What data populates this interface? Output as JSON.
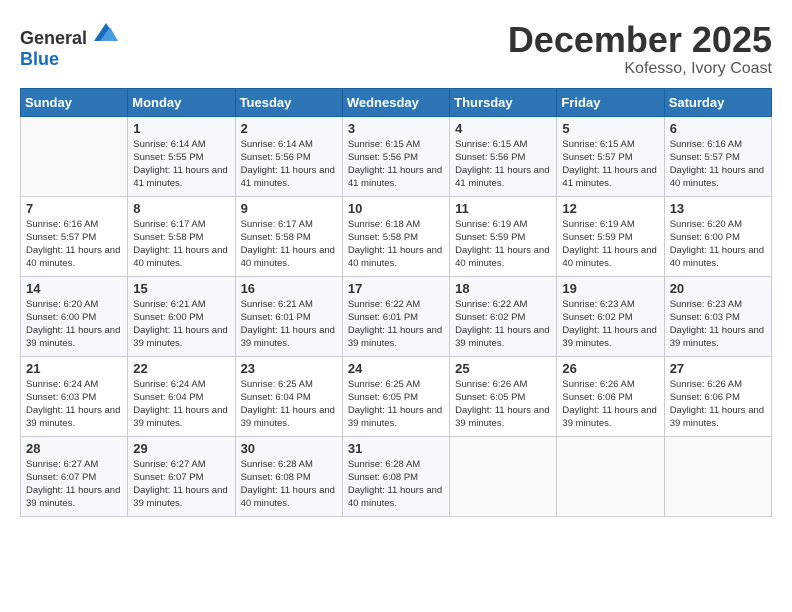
{
  "logo": {
    "general": "General",
    "blue": "Blue"
  },
  "title": {
    "month_year": "December 2025",
    "location": "Kofesso, Ivory Coast"
  },
  "weekdays": [
    "Sunday",
    "Monday",
    "Tuesday",
    "Wednesday",
    "Thursday",
    "Friday",
    "Saturday"
  ],
  "weeks": [
    [
      {
        "day": "",
        "sunrise": "",
        "sunset": "",
        "daylight": ""
      },
      {
        "day": "1",
        "sunrise": "Sunrise: 6:14 AM",
        "sunset": "Sunset: 5:55 PM",
        "daylight": "Daylight: 11 hours and 41 minutes."
      },
      {
        "day": "2",
        "sunrise": "Sunrise: 6:14 AM",
        "sunset": "Sunset: 5:56 PM",
        "daylight": "Daylight: 11 hours and 41 minutes."
      },
      {
        "day": "3",
        "sunrise": "Sunrise: 6:15 AM",
        "sunset": "Sunset: 5:56 PM",
        "daylight": "Daylight: 11 hours and 41 minutes."
      },
      {
        "day": "4",
        "sunrise": "Sunrise: 6:15 AM",
        "sunset": "Sunset: 5:56 PM",
        "daylight": "Daylight: 11 hours and 41 minutes."
      },
      {
        "day": "5",
        "sunrise": "Sunrise: 6:15 AM",
        "sunset": "Sunset: 5:57 PM",
        "daylight": "Daylight: 11 hours and 41 minutes."
      },
      {
        "day": "6",
        "sunrise": "Sunrise: 6:16 AM",
        "sunset": "Sunset: 5:57 PM",
        "daylight": "Daylight: 11 hours and 40 minutes."
      }
    ],
    [
      {
        "day": "7",
        "sunrise": "Sunrise: 6:16 AM",
        "sunset": "Sunset: 5:57 PM",
        "daylight": "Daylight: 11 hours and 40 minutes."
      },
      {
        "day": "8",
        "sunrise": "Sunrise: 6:17 AM",
        "sunset": "Sunset: 5:58 PM",
        "daylight": "Daylight: 11 hours and 40 minutes."
      },
      {
        "day": "9",
        "sunrise": "Sunrise: 6:17 AM",
        "sunset": "Sunset: 5:58 PM",
        "daylight": "Daylight: 11 hours and 40 minutes."
      },
      {
        "day": "10",
        "sunrise": "Sunrise: 6:18 AM",
        "sunset": "Sunset: 5:58 PM",
        "daylight": "Daylight: 11 hours and 40 minutes."
      },
      {
        "day": "11",
        "sunrise": "Sunrise: 6:19 AM",
        "sunset": "Sunset: 5:59 PM",
        "daylight": "Daylight: 11 hours and 40 minutes."
      },
      {
        "day": "12",
        "sunrise": "Sunrise: 6:19 AM",
        "sunset": "Sunset: 5:59 PM",
        "daylight": "Daylight: 11 hours and 40 minutes."
      },
      {
        "day": "13",
        "sunrise": "Sunrise: 6:20 AM",
        "sunset": "Sunset: 6:00 PM",
        "daylight": "Daylight: 11 hours and 40 minutes."
      }
    ],
    [
      {
        "day": "14",
        "sunrise": "Sunrise: 6:20 AM",
        "sunset": "Sunset: 6:00 PM",
        "daylight": "Daylight: 11 hours and 39 minutes."
      },
      {
        "day": "15",
        "sunrise": "Sunrise: 6:21 AM",
        "sunset": "Sunset: 6:00 PM",
        "daylight": "Daylight: 11 hours and 39 minutes."
      },
      {
        "day": "16",
        "sunrise": "Sunrise: 6:21 AM",
        "sunset": "Sunset: 6:01 PM",
        "daylight": "Daylight: 11 hours and 39 minutes."
      },
      {
        "day": "17",
        "sunrise": "Sunrise: 6:22 AM",
        "sunset": "Sunset: 6:01 PM",
        "daylight": "Daylight: 11 hours and 39 minutes."
      },
      {
        "day": "18",
        "sunrise": "Sunrise: 6:22 AM",
        "sunset": "Sunset: 6:02 PM",
        "daylight": "Daylight: 11 hours and 39 minutes."
      },
      {
        "day": "19",
        "sunrise": "Sunrise: 6:23 AM",
        "sunset": "Sunset: 6:02 PM",
        "daylight": "Daylight: 11 hours and 39 minutes."
      },
      {
        "day": "20",
        "sunrise": "Sunrise: 6:23 AM",
        "sunset": "Sunset: 6:03 PM",
        "daylight": "Daylight: 11 hours and 39 minutes."
      }
    ],
    [
      {
        "day": "21",
        "sunrise": "Sunrise: 6:24 AM",
        "sunset": "Sunset: 6:03 PM",
        "daylight": "Daylight: 11 hours and 39 minutes."
      },
      {
        "day": "22",
        "sunrise": "Sunrise: 6:24 AM",
        "sunset": "Sunset: 6:04 PM",
        "daylight": "Daylight: 11 hours and 39 minutes."
      },
      {
        "day": "23",
        "sunrise": "Sunrise: 6:25 AM",
        "sunset": "Sunset: 6:04 PM",
        "daylight": "Daylight: 11 hours and 39 minutes."
      },
      {
        "day": "24",
        "sunrise": "Sunrise: 6:25 AM",
        "sunset": "Sunset: 6:05 PM",
        "daylight": "Daylight: 11 hours and 39 minutes."
      },
      {
        "day": "25",
        "sunrise": "Sunrise: 6:26 AM",
        "sunset": "Sunset: 6:05 PM",
        "daylight": "Daylight: 11 hours and 39 minutes."
      },
      {
        "day": "26",
        "sunrise": "Sunrise: 6:26 AM",
        "sunset": "Sunset: 6:06 PM",
        "daylight": "Daylight: 11 hours and 39 minutes."
      },
      {
        "day": "27",
        "sunrise": "Sunrise: 6:26 AM",
        "sunset": "Sunset: 6:06 PM",
        "daylight": "Daylight: 11 hours and 39 minutes."
      }
    ],
    [
      {
        "day": "28",
        "sunrise": "Sunrise: 6:27 AM",
        "sunset": "Sunset: 6:07 PM",
        "daylight": "Daylight: 11 hours and 39 minutes."
      },
      {
        "day": "29",
        "sunrise": "Sunrise: 6:27 AM",
        "sunset": "Sunset: 6:07 PM",
        "daylight": "Daylight: 11 hours and 39 minutes."
      },
      {
        "day": "30",
        "sunrise": "Sunrise: 6:28 AM",
        "sunset": "Sunset: 6:08 PM",
        "daylight": "Daylight: 11 hours and 40 minutes."
      },
      {
        "day": "31",
        "sunrise": "Sunrise: 6:28 AM",
        "sunset": "Sunset: 6:08 PM",
        "daylight": "Daylight: 11 hours and 40 minutes."
      },
      {
        "day": "",
        "sunrise": "",
        "sunset": "",
        "daylight": ""
      },
      {
        "day": "",
        "sunrise": "",
        "sunset": "",
        "daylight": ""
      },
      {
        "day": "",
        "sunrise": "",
        "sunset": "",
        "daylight": ""
      }
    ]
  ]
}
